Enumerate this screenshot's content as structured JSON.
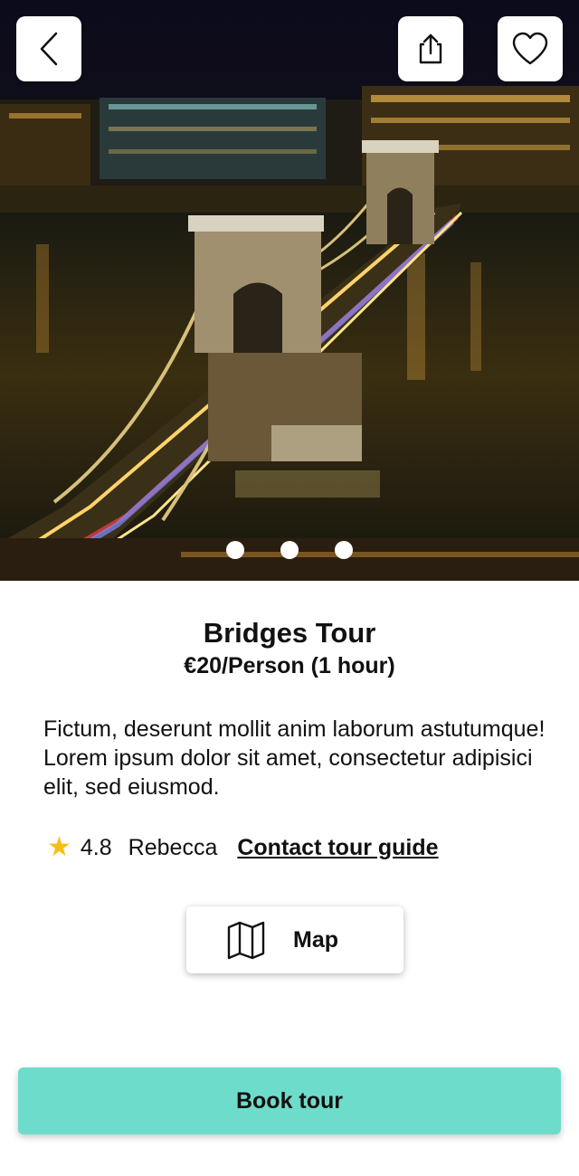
{
  "tour": {
    "title": "Bridges Tour",
    "price": "€20/Person (1 hour)",
    "description": "Fictum, deserunt mollit anim laborum astutumque! Lorem ipsum dolor sit amet, consectetur adipisici elit, sed eiusmod.",
    "rating": "4.8",
    "guide_name": "Rebecca",
    "contact_label": "Contact tour guide"
  },
  "gallery": {
    "dot_count": 3,
    "image_subject": "Night view of an illuminated chain bridge over a river"
  },
  "actions": {
    "map_label": "Map",
    "book_label": "Book tour"
  },
  "icons": {
    "back": "chevron-left-icon",
    "share": "share-icon",
    "favorite": "heart-icon",
    "rating": "star-icon",
    "map": "map-icon"
  },
  "colors": {
    "accent": "#6ddcca",
    "star": "#f6bf12"
  }
}
